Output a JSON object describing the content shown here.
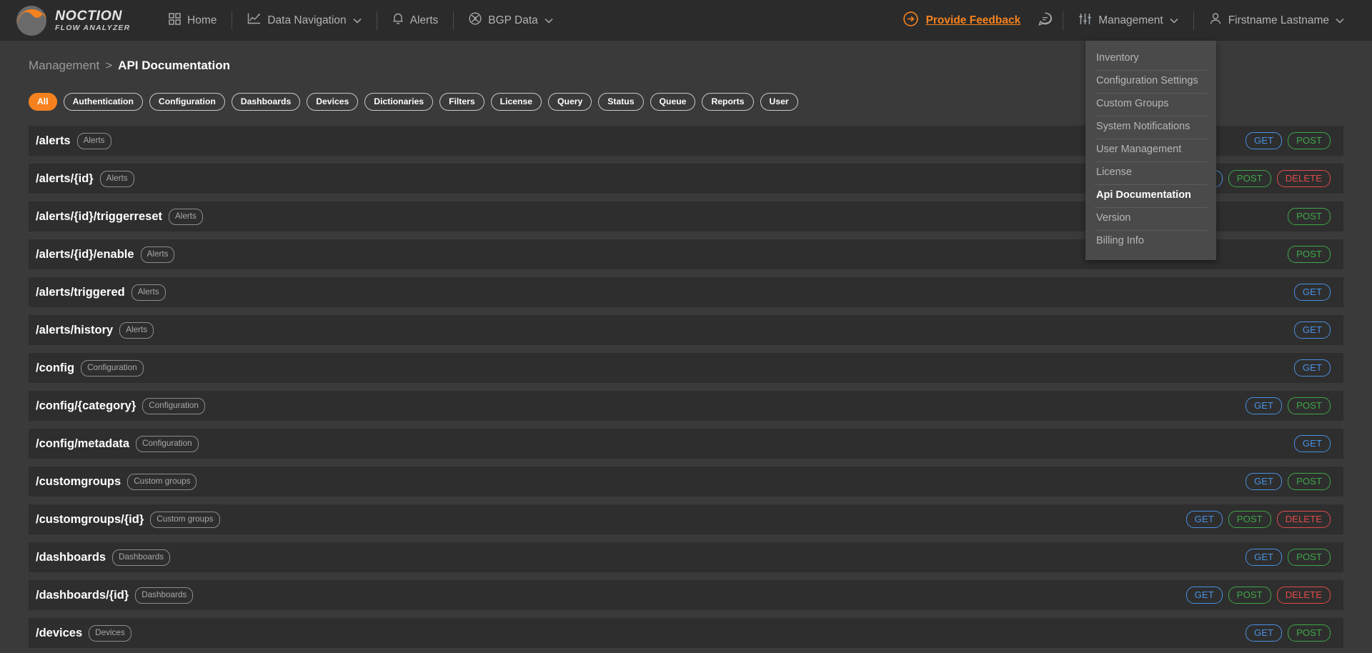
{
  "brand": {
    "title": "NOCTION",
    "subtitle": "FLOW ANALYZER"
  },
  "nav": {
    "items": [
      {
        "label": "Home",
        "icon": "grid-icon",
        "caret": false
      },
      {
        "label": "Data Navigation",
        "icon": "chart-line-icon",
        "caret": true
      },
      {
        "label": "Alerts",
        "icon": "bell-icon",
        "caret": false
      },
      {
        "label": "BGP Data",
        "icon": "bgp-icon",
        "caret": true
      }
    ],
    "feedback": {
      "label": "Provide Feedback",
      "icon": "arrow-right-circle-icon",
      "color": "#f5821f"
    },
    "chat_icon": "chat-bubble-icon",
    "management": {
      "label": "Management",
      "icon": "sliders-icon",
      "caret": true
    },
    "user": {
      "label": "Firstname Lastname",
      "icon": "user-icon",
      "caret": true
    }
  },
  "dropdown": {
    "items": [
      {
        "label": "Inventory",
        "active": false
      },
      {
        "label": "Configuration Settings",
        "active": false
      },
      {
        "label": "Custom Groups",
        "active": false
      },
      {
        "label": "System Notifications",
        "active": false
      },
      {
        "label": "User Management",
        "active": false
      },
      {
        "label": "License",
        "active": false
      },
      {
        "label": "Api Documentation",
        "active": true
      },
      {
        "label": "Version",
        "active": false
      },
      {
        "label": "Billing Info",
        "active": false
      }
    ]
  },
  "breadcrumb": {
    "root": "Management",
    "separator": ">",
    "leaf": "API Documentation"
  },
  "filters": [
    {
      "label": "All",
      "active": true
    },
    {
      "label": "Authentication",
      "active": false
    },
    {
      "label": "Configuration",
      "active": false
    },
    {
      "label": "Dashboards",
      "active": false
    },
    {
      "label": "Devices",
      "active": false
    },
    {
      "label": "Dictionaries",
      "active": false
    },
    {
      "label": "Filters",
      "active": false
    },
    {
      "label": "License",
      "active": false
    },
    {
      "label": "Query",
      "active": false
    },
    {
      "label": "Status",
      "active": false
    },
    {
      "label": "Queue",
      "active": false
    },
    {
      "label": "Reports",
      "active": false
    },
    {
      "label": "User",
      "active": false
    }
  ],
  "endpoints": [
    {
      "path": "/alerts",
      "tag": "Alerts",
      "methods": [
        "GET",
        "POST"
      ]
    },
    {
      "path": "/alerts/{id}",
      "tag": "Alerts",
      "methods": [
        "GET",
        "POST",
        "DELETE"
      ]
    },
    {
      "path": "/alerts/{id}/triggerreset",
      "tag": "Alerts",
      "methods": [
        "POST"
      ]
    },
    {
      "path": "/alerts/{id}/enable",
      "tag": "Alerts",
      "methods": [
        "POST"
      ]
    },
    {
      "path": "/alerts/triggered",
      "tag": "Alerts",
      "methods": [
        "GET"
      ]
    },
    {
      "path": "/alerts/history",
      "tag": "Alerts",
      "methods": [
        "GET"
      ]
    },
    {
      "path": "/config",
      "tag": "Configuration",
      "methods": [
        "GET"
      ]
    },
    {
      "path": "/config/{category}",
      "tag": "Configuration",
      "methods": [
        "GET",
        "POST"
      ]
    },
    {
      "path": "/config/metadata",
      "tag": "Configuration",
      "methods": [
        "GET"
      ]
    },
    {
      "path": "/customgroups",
      "tag": "Custom groups",
      "methods": [
        "GET",
        "POST"
      ]
    },
    {
      "path": "/customgroups/{id}",
      "tag": "Custom groups",
      "methods": [
        "GET",
        "POST",
        "DELETE"
      ]
    },
    {
      "path": "/dashboards",
      "tag": "Dashboards",
      "methods": [
        "GET",
        "POST"
      ]
    },
    {
      "path": "/dashboards/{id}",
      "tag": "Dashboards",
      "methods": [
        "GET",
        "POST",
        "DELETE"
      ]
    },
    {
      "path": "/devices",
      "tag": "Devices",
      "methods": [
        "GET",
        "POST"
      ]
    }
  ],
  "colors": {
    "accent": "#f5821f",
    "get": "#4a90e2",
    "post": "#3fa648",
    "delete": "#e24a4a"
  }
}
